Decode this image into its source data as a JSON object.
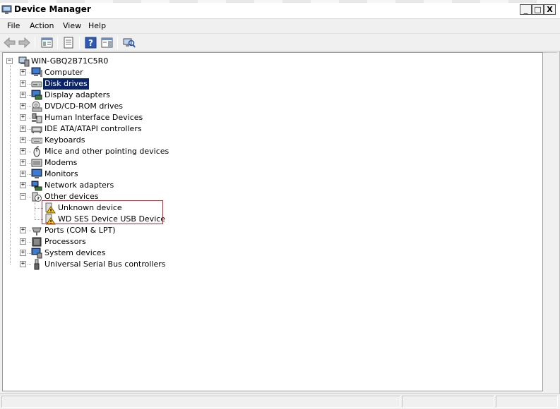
{
  "window": {
    "title": "Device Manager"
  },
  "window_controls": {
    "minimize": "_",
    "maximize": "□",
    "close": "X"
  },
  "menu": {
    "file": "File",
    "action": "Action",
    "view": "View",
    "help": "Help"
  },
  "toolbar": [
    "back-arrow-icon",
    "forward-arrow-icon",
    "show-hide-console-tree-icon",
    "properties-icon",
    "help-icon",
    "action-pane-icon",
    "scan-hardware-icon"
  ],
  "tree": {
    "root": "WIN-GBQ2B71C5R0",
    "categories": [
      {
        "label": "Computer",
        "icon": "computer-icon"
      },
      {
        "label": "Disk drives",
        "icon": "disk-drive-icon",
        "selected": true
      },
      {
        "label": "Display adapters",
        "icon": "display-adapter-icon"
      },
      {
        "label": "DVD/CD-ROM drives",
        "icon": "dvd-drive-icon"
      },
      {
        "label": "Human Interface Devices",
        "icon": "hid-icon"
      },
      {
        "label": "IDE ATA/ATAPI controllers",
        "icon": "ide-controller-icon"
      },
      {
        "label": "Keyboards",
        "icon": "keyboard-icon"
      },
      {
        "label": "Mice and other pointing devices",
        "icon": "mouse-icon"
      },
      {
        "label": "Modems",
        "icon": "modem-icon"
      },
      {
        "label": "Monitors",
        "icon": "monitor-icon"
      },
      {
        "label": "Network adapters",
        "icon": "network-adapter-icon"
      },
      {
        "label": "Other devices",
        "icon": "other-devices-icon",
        "expanded": true,
        "children": [
          {
            "label": "Unknown device",
            "icon": "warning-device-icon"
          },
          {
            "label": "WD SES Device USB Device",
            "icon": "warning-device-icon"
          }
        ]
      },
      {
        "label": "Ports (COM & LPT)",
        "icon": "port-icon"
      },
      {
        "label": "Processors",
        "icon": "processor-icon"
      },
      {
        "label": "System devices",
        "icon": "system-devices-icon"
      },
      {
        "label": "Universal Serial Bus controllers",
        "icon": "usb-icon"
      }
    ]
  },
  "colors": {
    "selection": "#0a246a",
    "highlight_box": "#d0222c",
    "warning": "#f2c200"
  }
}
